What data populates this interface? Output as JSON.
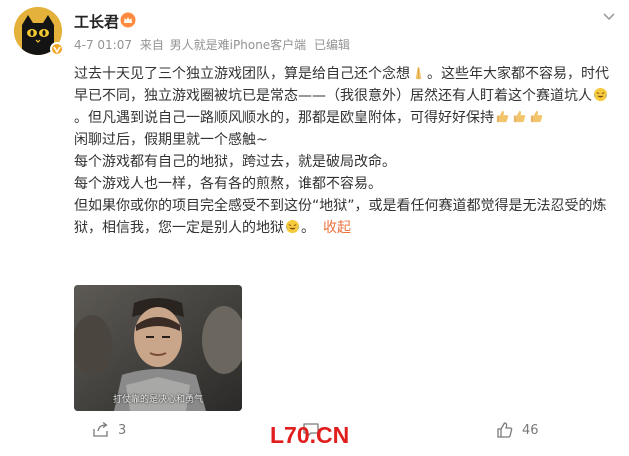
{
  "post": {
    "author": "工长君",
    "time": "4-7 01:07",
    "source_prefix": "来自",
    "source": "男人就是难iPhone客户端",
    "edited": "已编辑",
    "lines": [
      "过去十天见了三个独立游戏团队，算是给自己还个念想",
      "。这些年大家都不容易，时代早已不同，独立游戏圈被坑已是常态——（我很意外）居然还有人盯着这个赛道坑人",
      "。但凡遇到说自己一路顺风顺水的，那都是欧皇附体，可得好好保持"
    ],
    "line2": "闲聊过后，假期里就一个感触~",
    "line3": "每个游戏都有自己的地狱，跨过去，就是破局改命。",
    "line4": "每个游戏人也一样，各有各的煎熬，谁都不容易。",
    "line5_a": "但如果你或你的项目完全感受不到这份“地狱”，或是看任何赛道都觉得是无法忍受的炼狱，相信我，您一定是别人的地狱",
    "line5_b": "。",
    "fold_label": "收起",
    "media_subtitle": "打仗靠的是决心和勇气",
    "repost_count": "3",
    "like_count": "46"
  },
  "watermark": "L70.CN",
  "icons": {
    "avatar": "black-cat-avatar",
    "verified": "verified-badge-icon",
    "crown": "vip-crown-icon",
    "more": "chevron-down-icon",
    "emoji_pray": "pray-emoji-icon",
    "emoji_cry": "crying-laugh-emoji-icon",
    "emoji_thumb": "thumbs-up-emoji-icon",
    "repost": "repost-icon",
    "comment": "comment-icon",
    "like": "like-icon"
  },
  "colors": {
    "fold": "#eb7340",
    "watermark": "#e01e1e",
    "meta": "#939393"
  }
}
